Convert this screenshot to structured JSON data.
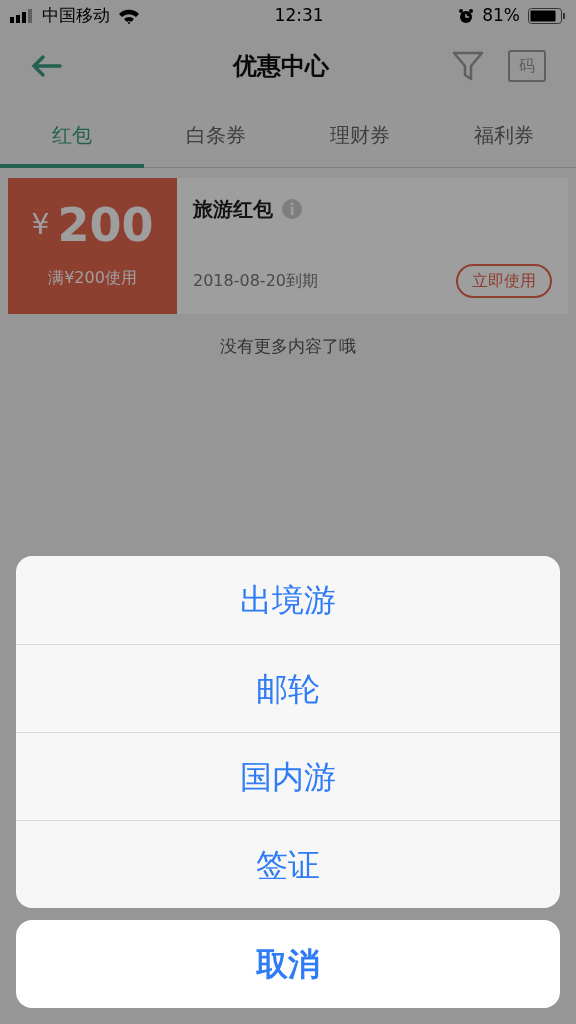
{
  "status_bar": {
    "carrier": "中国移动",
    "time": "12:31",
    "battery": "81%"
  },
  "header": {
    "title": "优惠中心",
    "code_label": "码"
  },
  "tabs": [
    {
      "label": "红包",
      "selected": true
    },
    {
      "label": "白条券",
      "selected": false
    },
    {
      "label": "理财券",
      "selected": false
    },
    {
      "label": "福利券",
      "selected": false
    }
  ],
  "coupons": [
    {
      "currency": "¥",
      "amount": "200",
      "condition": "满¥200使用",
      "name": "旅游红包",
      "expiry": "2018-08-20到期",
      "action": "立即使用"
    }
  ],
  "list_end": "没有更多内容了哦",
  "action_sheet": {
    "options": [
      "出境游",
      "邮轮",
      "国内游",
      "签证"
    ],
    "cancel": "取消"
  }
}
